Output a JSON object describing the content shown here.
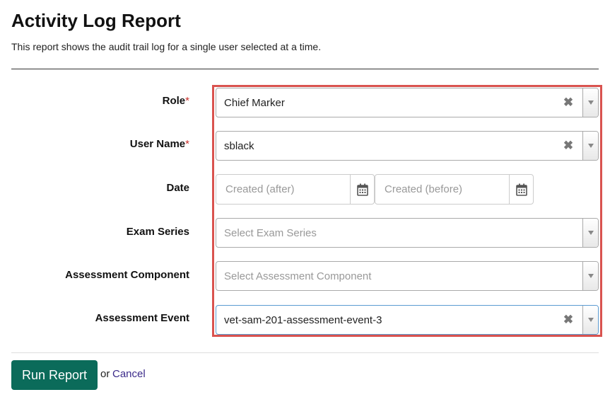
{
  "header": {
    "title": "Activity Log Report",
    "description": "This report shows the audit trail log for a single user selected at a time."
  },
  "form": {
    "role": {
      "label": "Role",
      "required_mark": "*",
      "value": "Chief Marker"
    },
    "user_name": {
      "label": "User Name",
      "required_mark": "*",
      "value": "sblack"
    },
    "date": {
      "label": "Date",
      "after_placeholder": "Created (after)",
      "before_placeholder": "Created (before)"
    },
    "exam_series": {
      "label": "Exam Series",
      "placeholder": "Select Exam Series"
    },
    "assessment_component": {
      "label": "Assessment Component",
      "placeholder": "Select Assessment Component"
    },
    "assessment_event": {
      "label": "Assessment Event",
      "value": "vet-sam-201-assessment-event-3"
    },
    "clear_glyph": "✖"
  },
  "actions": {
    "run_label": "Run Report",
    "or_text": "or",
    "cancel_label": "Cancel"
  },
  "colors": {
    "highlight": "#d9534f",
    "primary_button": "#0b6b5a",
    "required": "#c9302c",
    "link": "#3b2a8a"
  },
  "icons": {
    "calendar": "calendar-icon",
    "dropdown": "chevron-down-icon",
    "clear": "close-icon"
  }
}
